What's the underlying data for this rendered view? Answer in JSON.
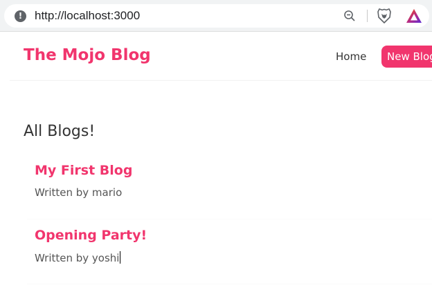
{
  "browser": {
    "url": "http://localhost:3000",
    "icons": {
      "site_info": "info-icon",
      "zoom": "zoom-out-icon",
      "shields": "brave-lion-icon",
      "rewards": "brave-rewards-triangle-icon"
    }
  },
  "navbar": {
    "title": "The Mojo Blog",
    "links": {
      "home": "Home",
      "new_blog": "New Blog"
    }
  },
  "main": {
    "heading": "All Blogs!",
    "blogs": [
      {
        "title": "My First Blog",
        "author": "Written by mario"
      },
      {
        "title": "Opening Party!",
        "author": "Written by yoshi"
      }
    ]
  },
  "colors": {
    "accent": "#f1356d",
    "text": "#333333",
    "button_text": "#ffffff"
  }
}
